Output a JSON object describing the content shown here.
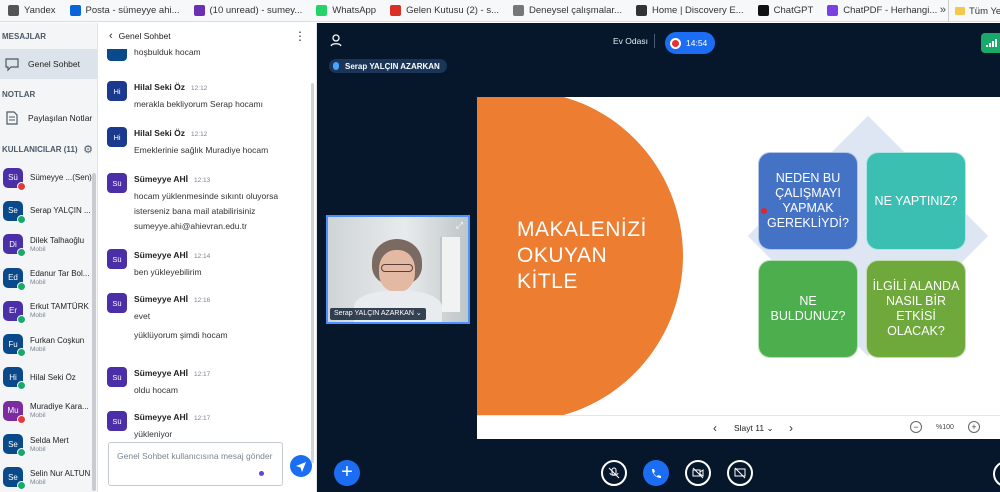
{
  "bookmarks": {
    "items": [
      {
        "label": "Yandex",
        "color": "#555"
      },
      {
        "label": "Posta - sümeyye ahi...",
        "color": "#0a64d8"
      },
      {
        "label": "(10 unread) - sumey...",
        "color": "#6b2fb3"
      },
      {
        "label": "WhatsApp",
        "color": "#25d366"
      },
      {
        "label": "Gelen Kutusu (2) - s...",
        "color": "#d93025"
      },
      {
        "label": "Deneysel çalışmalar...",
        "color": "#777"
      },
      {
        "label": "Home | Discovery E...",
        "color": "#333"
      },
      {
        "label": "ChatGPT",
        "color": "#111"
      },
      {
        "label": "ChatPDF - Herhangi...",
        "color": "#7b3fe4"
      }
    ],
    "more": "»",
    "all": "Tüm Yer İmleri"
  },
  "sidebar": {
    "messages_heading": "MESAJLAR",
    "public_chat": "Genel Sohbet",
    "notes_heading": "NOTLAR",
    "shared_notes": "Paylaşılan Notlar",
    "users_heading": "KULLANICILAR (11)",
    "users": [
      {
        "initials": "Sü",
        "name": "Sümeyye ...(Sen)",
        "role": "",
        "color": "#4b2fa8",
        "badge": "#e33b3b"
      },
      {
        "initials": "Se",
        "name": "Serap YALÇIN ...",
        "role": "",
        "color": "#0a4a8a",
        "badge": "#18a96b"
      },
      {
        "initials": "Di",
        "name": "Dilek Talhaoğlu",
        "role": "Mobil",
        "color": "#4b2fa8",
        "badge": "#18a96b"
      },
      {
        "initials": "Ed",
        "name": "Edanur Tar Bol...",
        "role": "Mobil",
        "color": "#0a4a8a",
        "badge": "#18a96b"
      },
      {
        "initials": "Er",
        "name": "Erkut TAMTÜRK",
        "role": "Mobil",
        "color": "#4b2fa8",
        "badge": "#18a96b"
      },
      {
        "initials": "Fu",
        "name": "Furkan Coşkun",
        "role": "Mobil",
        "color": "#0a4a8a",
        "badge": "#18a96b"
      },
      {
        "initials": "Hi",
        "name": "Hilal Seki Öz",
        "role": "",
        "color": "#0a4a8a",
        "badge": "#18a96b"
      },
      {
        "initials": "Mu",
        "name": "Muradiye Kara...",
        "role": "Mobil",
        "color": "#7a2ca0",
        "badge": "#e33b3b"
      },
      {
        "initials": "Se",
        "name": "Selda Mert",
        "role": "Mobil",
        "color": "#0a4a8a",
        "badge": "#18a96b"
      },
      {
        "initials": "Se",
        "name": "Selin Nur ALTUN",
        "role": "Mobil",
        "color": "#0a4a8a",
        "badge": "#18a96b"
      }
    ]
  },
  "chat": {
    "title": "Genel Sohbet",
    "messages": [
      {
        "initials": "",
        "sender": "",
        "time": "",
        "lines": [
          "hoşbulduk hocam"
        ],
        "color": "#0a4a8a"
      },
      {
        "initials": "Hi",
        "sender": "Hilal Seki Öz",
        "time": "12:12",
        "lines": [
          "merakla bekliyorum Serap hocamı"
        ],
        "color": "#1b3a8f"
      },
      {
        "initials": "Hi",
        "sender": "Hilal Seki Öz",
        "time": "12:12",
        "lines": [
          "Emeklerinie sağlık Muradiye hocam"
        ],
        "color": "#1b3a8f"
      },
      {
        "initials": "Sü",
        "sender": "Sümeyye AHİ",
        "time": "12:13",
        "lines": [
          "hocam yüklenmesinde sıkıntı oluyorsa",
          "isterseniz bana mail atabilirisiniz",
          "sumeyye.ahi@ahievran.edu.tr"
        ],
        "color": "#4b2fa8"
      },
      {
        "initials": "Sü",
        "sender": "Sümeyye AHİ",
        "time": "12:14",
        "lines": [
          "ben yükleyebilirim"
        ],
        "color": "#4b2fa8"
      },
      {
        "initials": "Sü",
        "sender": "Sümeyye AHİ",
        "time": "12:16",
        "lines": [
          "evet",
          "yüklüyorum şimdi hocam"
        ],
        "color": "#4b2fa8"
      },
      {
        "initials": "Sü",
        "sender": "Sümeyye AHİ",
        "time": "12:17",
        "lines": [
          "oldu hocam"
        ],
        "color": "#4b2fa8"
      },
      {
        "initials": "Sü",
        "sender": "Sümeyye AHİ",
        "time": "12:17",
        "lines": [
          "yükleniyor"
        ],
        "color": "#4b2fa8"
      }
    ],
    "placeholder": "Genel Sohbet kullanıcısına mesaj gönder"
  },
  "meeting": {
    "room": "Ev Odası",
    "recording_time": "14:54",
    "presenter": "Serap YALÇIN AZARKAN",
    "webcam_label": "Serap YALÇIN AZARKAN",
    "slide": {
      "title_lines": [
        "MAKALENİZİ",
        "OKUYAN",
        "KİTLE"
      ],
      "boxes": [
        "NEDEN BU ÇALIŞMAYI YAPMAK GEREKLİYDİ?",
        "NE YAPTINIZ?",
        "NE BULDUNUZ?",
        "İLGİLİ ALANDA NASIL BİR ETKİSİ OLACAK?"
      ]
    },
    "slide_label": "Slayt 11",
    "zoom": "%100",
    "colors": {
      "accent": "#1b6ef3",
      "background": "#06172b",
      "orange": "#ed7d31"
    }
  }
}
